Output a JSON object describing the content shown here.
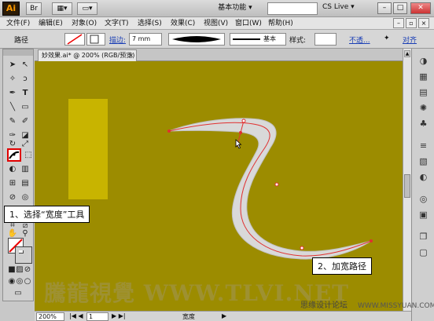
{
  "titlebar": {
    "logo": "Ai",
    "workspace": "基本功能 ▾",
    "cs_live": "CS Live ▾",
    "minimize": "–",
    "maximize": "□",
    "close": "✕"
  },
  "menubar": {
    "items": [
      "文件(F)",
      "编辑(E)",
      "对象(O)",
      "文字(T)",
      "选择(S)",
      "效果(C)",
      "视图(V)",
      "窗口(W)",
      "帮助(H)"
    ]
  },
  "control_bar": {
    "label": "路径",
    "stroke_label": "描边:",
    "stroke_value": "7 mm",
    "profile_label": "基本",
    "style_label": "样式:",
    "opacity_label": "不透...",
    "align_label": "对齐"
  },
  "document": {
    "tab_title": "妙效果.ai* @ 200% (RGB/预览)",
    "tab_close": "×"
  },
  "status_bar": {
    "zoom": "200%",
    "page": "1",
    "tool_name": "宽度"
  },
  "callouts": {
    "step1": "1、选择“宽度”工具",
    "step2": "2、加宽路径"
  },
  "watermarks": {
    "main": "騰龍視覺 WWW.TLVI.NET",
    "forum": "思缘设计论坛",
    "url": "WWW.MISSYUAN.COM"
  },
  "colors": {
    "canvas": "#9c8c00",
    "rectangle": "#c8b400",
    "path_fill": "#d9d9d9",
    "path_stroke": "#e03030",
    "highlight": "#e00000"
  }
}
